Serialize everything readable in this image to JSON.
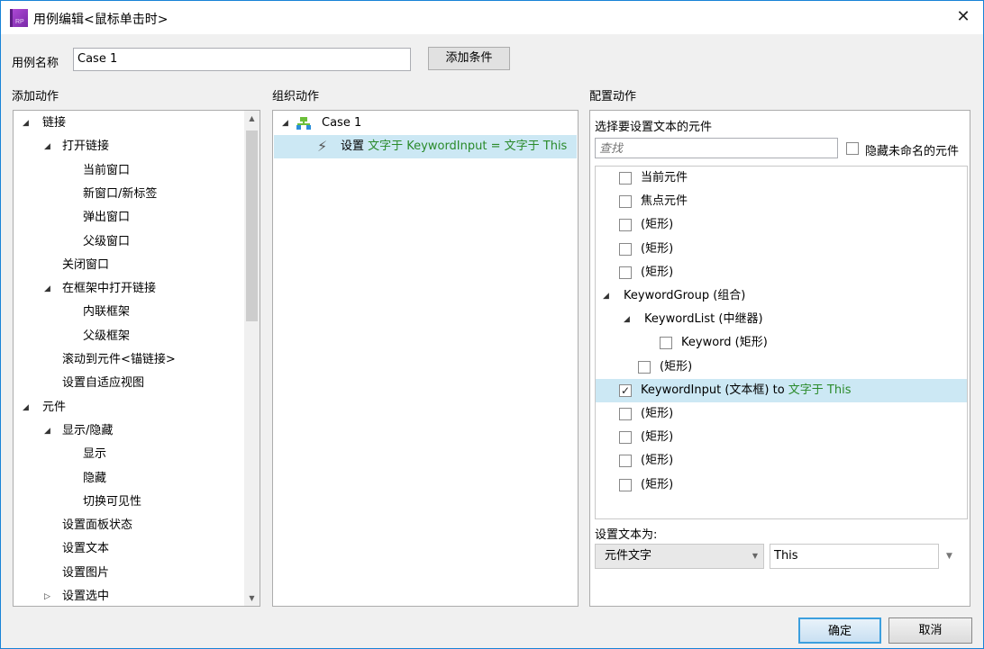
{
  "window": {
    "title": "用例编辑<鼠标单击时>",
    "close": "✕"
  },
  "case_name": {
    "label": "用例名称",
    "value": "Case 1",
    "add_condition": "添加条件"
  },
  "add_action": {
    "header": "添加动作",
    "items": [
      {
        "label": "链接",
        "level": 0,
        "expander": "expanded"
      },
      {
        "label": "打开链接",
        "level": 1,
        "expander": "expanded"
      },
      {
        "label": "当前窗口",
        "level": 2
      },
      {
        "label": "新窗口/新标签",
        "level": 2
      },
      {
        "label": "弹出窗口",
        "level": 2
      },
      {
        "label": "父级窗口",
        "level": 2
      },
      {
        "label": "关闭窗口",
        "level": 1
      },
      {
        "label": "在框架中打开链接",
        "level": 1,
        "expander": "expanded"
      },
      {
        "label": "内联框架",
        "level": 2
      },
      {
        "label": "父级框架",
        "level": 2
      },
      {
        "label": "滚动到元件<锚链接>",
        "level": 1
      },
      {
        "label": "设置自适应视图",
        "level": 1
      },
      {
        "label": "元件",
        "level": 0,
        "expander": "expanded"
      },
      {
        "label": "显示/隐藏",
        "level": 1,
        "expander": "expanded"
      },
      {
        "label": "显示",
        "level": 2
      },
      {
        "label": "隐藏",
        "level": 2
      },
      {
        "label": "切换可见性",
        "level": 2
      },
      {
        "label": "设置面板状态",
        "level": 1
      },
      {
        "label": "设置文本",
        "level": 1
      },
      {
        "label": "设置图片",
        "level": 1
      },
      {
        "label": "设置选中",
        "level": 1,
        "expander": "collapsed"
      }
    ]
  },
  "organize": {
    "header": "组织动作",
    "case_label": "Case 1",
    "action_prefix": "设置",
    "action_detail": "文字于 KeywordInput = 文字于 This"
  },
  "configure": {
    "header": "配置动作",
    "subheader": "选择要设置文本的元件",
    "search_placeholder": "查找",
    "hide_unnamed": "隐藏未命名的元件",
    "widgets": [
      {
        "label": "当前元件",
        "type": "cb",
        "level": 0,
        "checked": false
      },
      {
        "label": "焦点元件",
        "type": "cb",
        "level": 0,
        "checked": false
      },
      {
        "label": "(矩形)",
        "type": "cb",
        "level": 0,
        "checked": false
      },
      {
        "label": "(矩形)",
        "type": "cb",
        "level": 0,
        "checked": false
      },
      {
        "label": "(矩形)",
        "type": "cb",
        "level": 0,
        "checked": false
      },
      {
        "label": "KeywordGroup (组合)",
        "type": "group",
        "level": 0
      },
      {
        "label": "KeywordList (中继器)",
        "type": "group",
        "level": 1
      },
      {
        "label": "Keyword (矩形)",
        "type": "cb",
        "level": 2,
        "checked": false
      },
      {
        "label": "(矩形)",
        "type": "cb",
        "level": 1,
        "checked": false
      },
      {
        "label": "KeywordInput (文本框)",
        "suffix": " to ",
        "target": "文字于 This",
        "type": "cb",
        "level": 0,
        "checked": true,
        "selected": true
      },
      {
        "label": "(矩形)",
        "type": "cb",
        "level": 0,
        "checked": false
      },
      {
        "label": "(矩形)",
        "type": "cb",
        "level": 0,
        "checked": false
      },
      {
        "label": "(矩形)",
        "type": "cb",
        "level": 0,
        "checked": false
      },
      {
        "label": "(矩形)",
        "type": "cb",
        "level": 0,
        "checked": false
      }
    ],
    "set_text_label": "设置文本为:",
    "type_select": "元件文字",
    "value": "This"
  },
  "footer": {
    "ok": "确定",
    "cancel": "取消"
  },
  "colors": {
    "accent": "#1883d7",
    "selected_row": "#cce8f4",
    "green_text": "#2a8a2a"
  }
}
